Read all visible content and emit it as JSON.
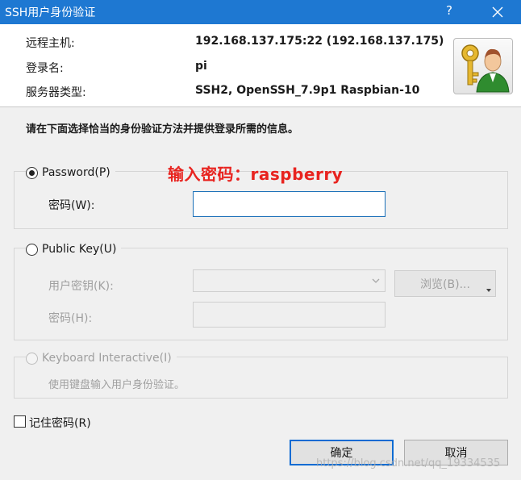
{
  "window": {
    "title": "SSH用户身份验证",
    "help": "?"
  },
  "host_info": {
    "remote_host_label": "远程主机:",
    "remote_host_value": "192.168.137.175:22 (192.168.137.175)",
    "login_label": "登录名:",
    "login_value": "pi",
    "server_type_label": "服务器类型:",
    "server_type_value": "SSH2, OpenSSH_7.9p1 Raspbian-10"
  },
  "instruction": "请在下面选择恰当的身份验证方法并提供登录所需的信息。",
  "annotation": "输入密码：raspberry",
  "password_method": {
    "label": "Password(P)",
    "checked": true,
    "field_label": "密码(W):",
    "value": ""
  },
  "public_key_method": {
    "label": "Public Key(U)",
    "checked": false,
    "user_key_label": "用户密钥(K):",
    "browse_label": "浏览(B)...",
    "passphrase_label": "密码(H):"
  },
  "keyboard_interactive": {
    "label": "Keyboard Interactive(I)",
    "description": "使用键盘输入用户身份验证。"
  },
  "remember_password_label": "记住密码(R)",
  "buttons": {
    "ok": "确定",
    "cancel": "取消"
  },
  "watermark": "https://blog.csdn.net/qq_19334535",
  "colors": {
    "titlebar": "#1e78d2",
    "annotation": "#e8231f",
    "primary_border": "#0c6bd3"
  }
}
